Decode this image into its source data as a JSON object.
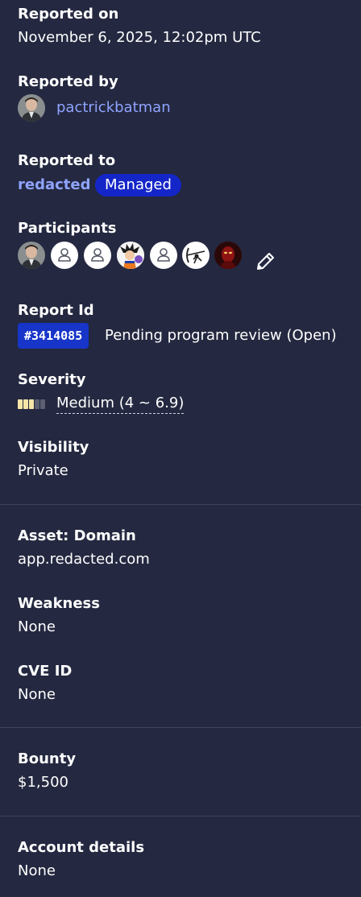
{
  "reported_on": {
    "label": "Reported on",
    "value": "November 6, 2025, 12:02pm UTC"
  },
  "reported_by": {
    "label": "Reported by",
    "username": "pactrickbatman"
  },
  "reported_to": {
    "label": "Reported to",
    "program": "redacted",
    "badge": "Managed"
  },
  "participants": {
    "label": "Participants",
    "count": 7,
    "edit_icon": "pencil-icon"
  },
  "report_id": {
    "label": "Report Id",
    "id": "#3414085",
    "status": "Pending program review (Open)"
  },
  "severity": {
    "label": "Severity",
    "value": "Medium (4 ~ 6.9)",
    "level": 3,
    "max_level": 5,
    "active_color": "#f5e6a8",
    "inactive_color": "#5c5f72"
  },
  "visibility": {
    "label": "Visibility",
    "value": "Private"
  },
  "asset": {
    "label": "Asset: Domain",
    "value": "app.redacted.com"
  },
  "weakness": {
    "label": "Weakness",
    "value": "None"
  },
  "cve": {
    "label": "CVE ID",
    "value": "None"
  },
  "bounty": {
    "label": "Bounty",
    "value": "$1,500"
  },
  "account_details": {
    "label": "Account details",
    "value": "None"
  },
  "colors": {
    "background": "#242840",
    "link": "#8fa4ff",
    "managed_badge": "#1426c8",
    "report_id_badge": "#1735c9",
    "divider": "#3d425d"
  }
}
